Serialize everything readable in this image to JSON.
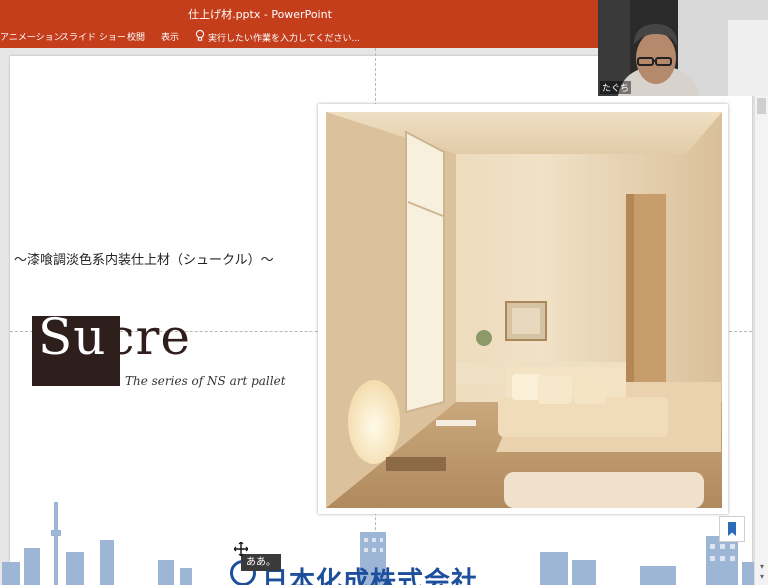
{
  "window": {
    "title": "仕上げ材.pptx - PowerPoint"
  },
  "ribbon": {
    "tabs": [
      {
        "label": "アニメーション"
      },
      {
        "label": "スライド ショー"
      },
      {
        "label": "校閲"
      },
      {
        "label": "表示"
      }
    ],
    "tell_me_placeholder": "実行したい作業を入力してください..."
  },
  "slide": {
    "subtitle": "～漆喰調淡色系内装仕上材（シュークル）～",
    "logo": {
      "wordmark": "Sucre",
      "tagline": "The series of NS art pallet"
    },
    "company": "日本化成株式会社"
  },
  "ime_tooltip": "ああ。",
  "webcam": {
    "participant_name": "たぐち"
  },
  "colors": {
    "ribbon": "#c43e1c",
    "logo_dark": "#2e1f1c",
    "brand_blue": "#1d4f9c"
  },
  "icons": {
    "lightbulb": "lightbulb-icon",
    "bookmark": "bookmark-icon",
    "cursor": "move-cursor-icon"
  }
}
